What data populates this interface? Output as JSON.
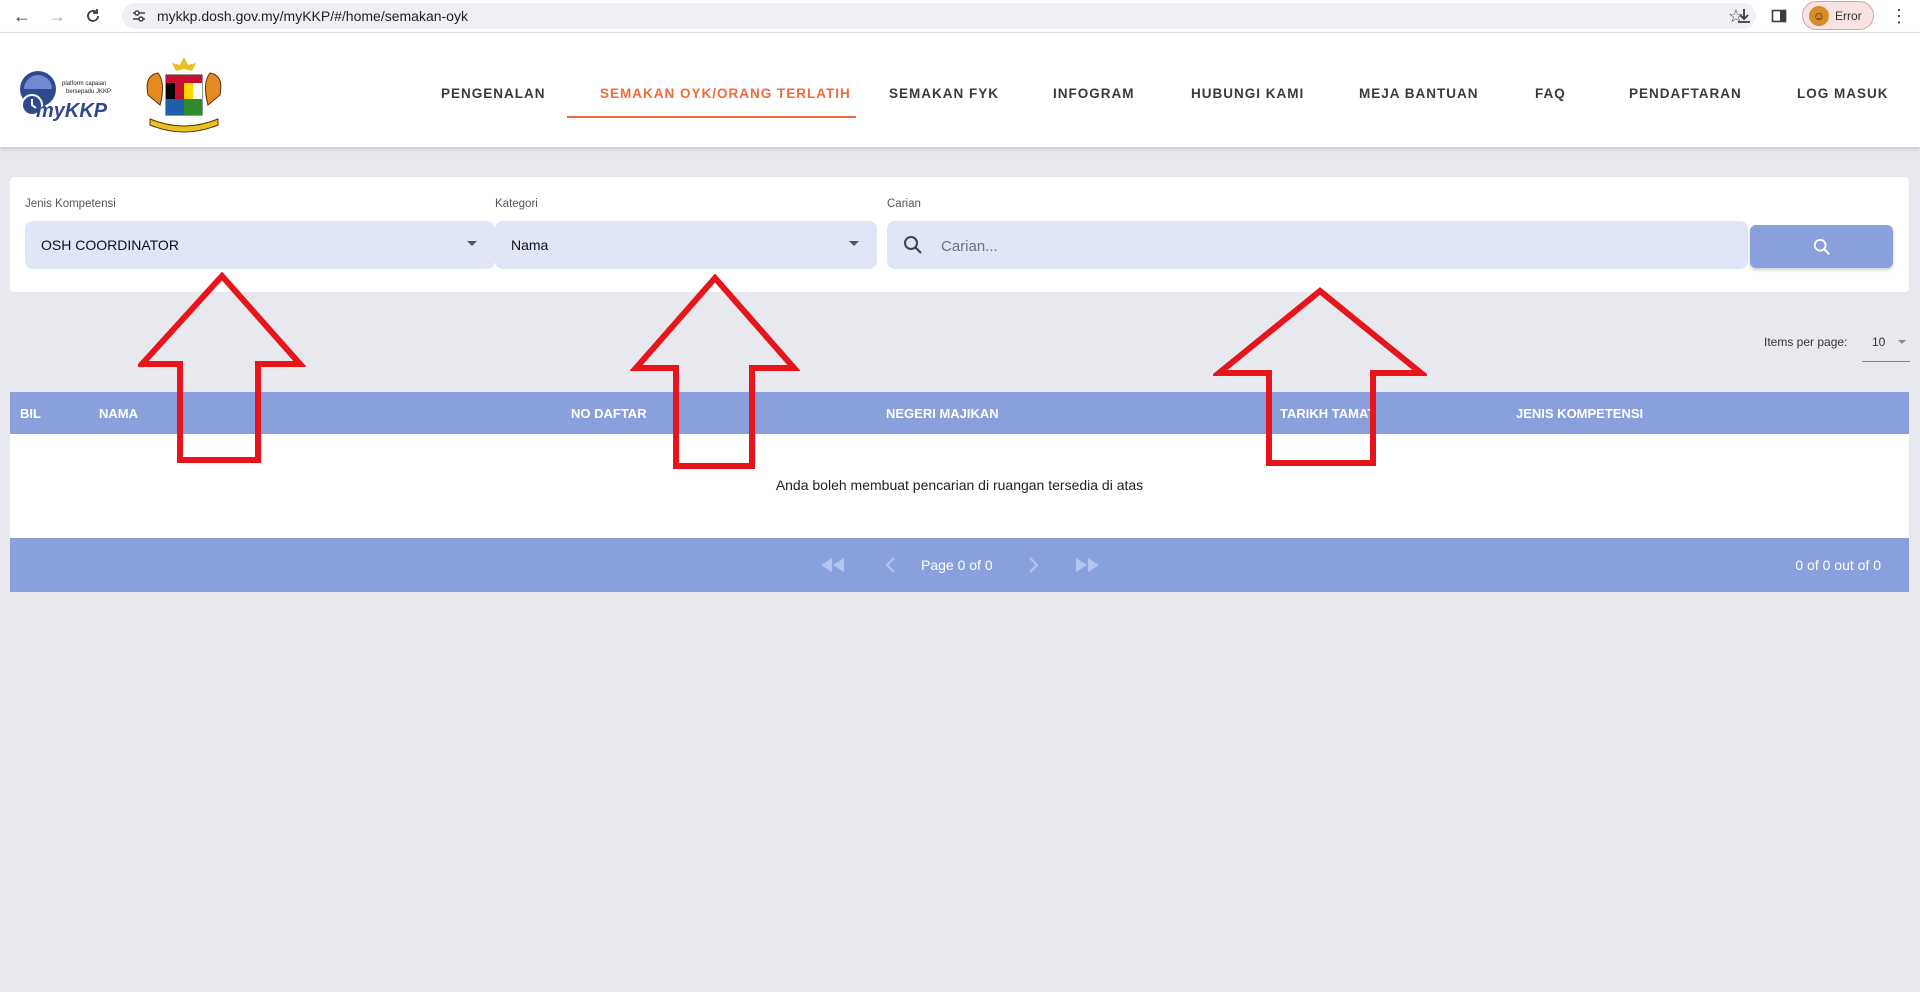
{
  "browser": {
    "url": "mykkp.dosh.gov.my/myKKP/#/home/semakan-oyk",
    "profile_label": "Error"
  },
  "header": {
    "logo_text": "myKKP",
    "logo_tagline": "platform capaian bersepadu JKKP",
    "nav": [
      {
        "label": "PENGENALAN",
        "active": false
      },
      {
        "label": "SEMAKAN OYK/ORANG TERLATIH",
        "active": true
      },
      {
        "label": "SEMAKAN FYK",
        "active": false
      },
      {
        "label": "INFOGRAM",
        "active": false
      },
      {
        "label": "HUBUNGI KAMI",
        "active": false
      },
      {
        "label": "MEJA BANTUAN",
        "active": false
      },
      {
        "label": "FAQ",
        "active": false
      },
      {
        "label": "PENDAFTARAN",
        "active": false
      },
      {
        "label": "LOG MASUK",
        "active": false
      }
    ],
    "active_color": "#f26a3a"
  },
  "filters": {
    "jenis_label": "Jenis Kompetensi",
    "jenis_value": "OSH COORDINATOR",
    "kategori_label": "Kategori",
    "kategori_value": "Nama",
    "carian_label": "Carian",
    "carian_placeholder": "Carian..."
  },
  "paging": {
    "items_per_page_label": "Items per page:",
    "items_per_page_value": "10",
    "page_text": "Page 0 of 0",
    "count_text": "0 of 0 out of 0"
  },
  "table": {
    "columns": [
      "BIL",
      "NAMA",
      "NO DAFTAR",
      "NEGERI MAJIKAN",
      "TARIKH TAMAT",
      "JENIS KOMPETENSI"
    ],
    "empty_message": "Anda boleh membuat pencarian di ruangan tersedia di atas",
    "accent_color": "#8aa0dd"
  },
  "annotations": {
    "arrow_color": "#e8141c"
  }
}
